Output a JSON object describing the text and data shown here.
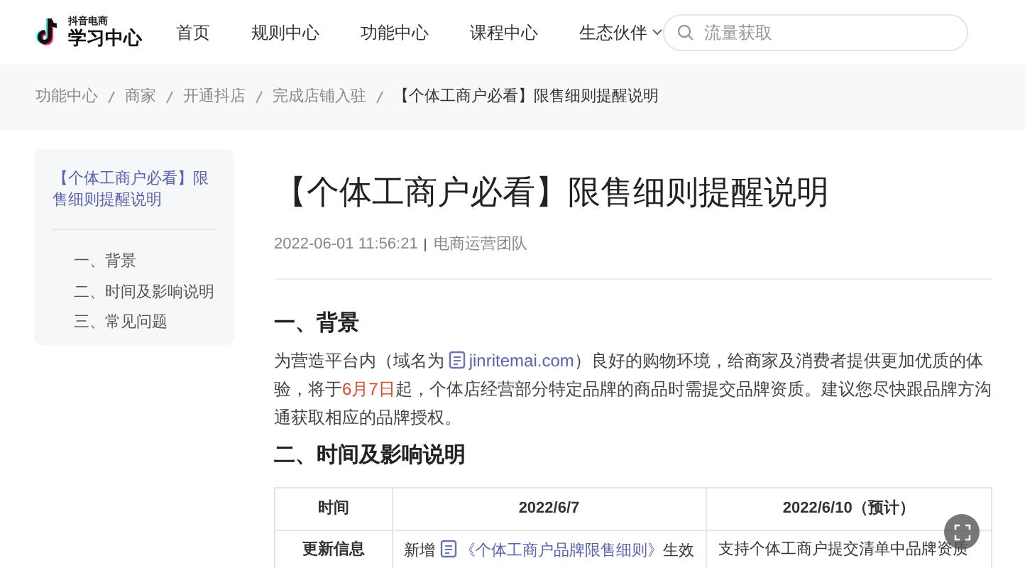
{
  "header": {
    "logo_small": "抖音电商",
    "logo_title": "学习中心",
    "nav": [
      {
        "label": "首页",
        "dropdown": false
      },
      {
        "label": "规则中心",
        "dropdown": false
      },
      {
        "label": "功能中心",
        "dropdown": false
      },
      {
        "label": "课程中心",
        "dropdown": false
      },
      {
        "label": "生态伙伴",
        "dropdown": true
      }
    ],
    "search": {
      "placeholder": "流量获取"
    }
  },
  "breadcrumb": [
    "功能中心",
    "商家",
    "开通抖店",
    "完成店铺入驻",
    "【个体工商户必看】限售细则提醒说明"
  ],
  "toc": {
    "title": "【个体工商户必看】限售细则提醒说明",
    "items": [
      "一、背景",
      "二、时间及影响说明",
      "三、常见问题"
    ]
  },
  "article": {
    "title": "【个体工商户必看】限售细则提醒说明",
    "date": "2022-06-01 11:56:21",
    "author": "电商运营团队",
    "sections": [
      {
        "heading": "一、背景",
        "paragraph": [
          {
            "kind": "text",
            "text": "为营造平台内（域名为 "
          },
          {
            "kind": "link",
            "text": "jinritemai.com"
          },
          {
            "kind": "text",
            "text": "）良好的购物环境，给商家及消费者提供更加优质的体验，将于"
          },
          {
            "kind": "highlight",
            "text": "6月7日"
          },
          {
            "kind": "text",
            "text": "起，个体店经营部分特定品牌的商品时需提交品牌资质。建议您尽快跟品牌方沟通获取相应的品牌授权。"
          }
        ]
      },
      {
        "heading": "二、时间及影响说明"
      }
    ],
    "table": {
      "columns": [
        "时间",
        "2022/6/7",
        "2022/6/10（预计）"
      ],
      "rows": [
        [
          [
            {
              "kind": "text",
              "text": "更新信息"
            }
          ],
          [
            {
              "kind": "text",
              "text": "新增 "
            },
            {
              "kind": "link",
              "text": "《个体工商户品牌限售细则》"
            },
            {
              "kind": "text",
              "text": "生效"
            }
          ],
          [
            {
              "kind": "text",
              "text": "支持个体工商户提交清单中品牌资质"
            }
          ]
        ]
      ]
    }
  }
}
